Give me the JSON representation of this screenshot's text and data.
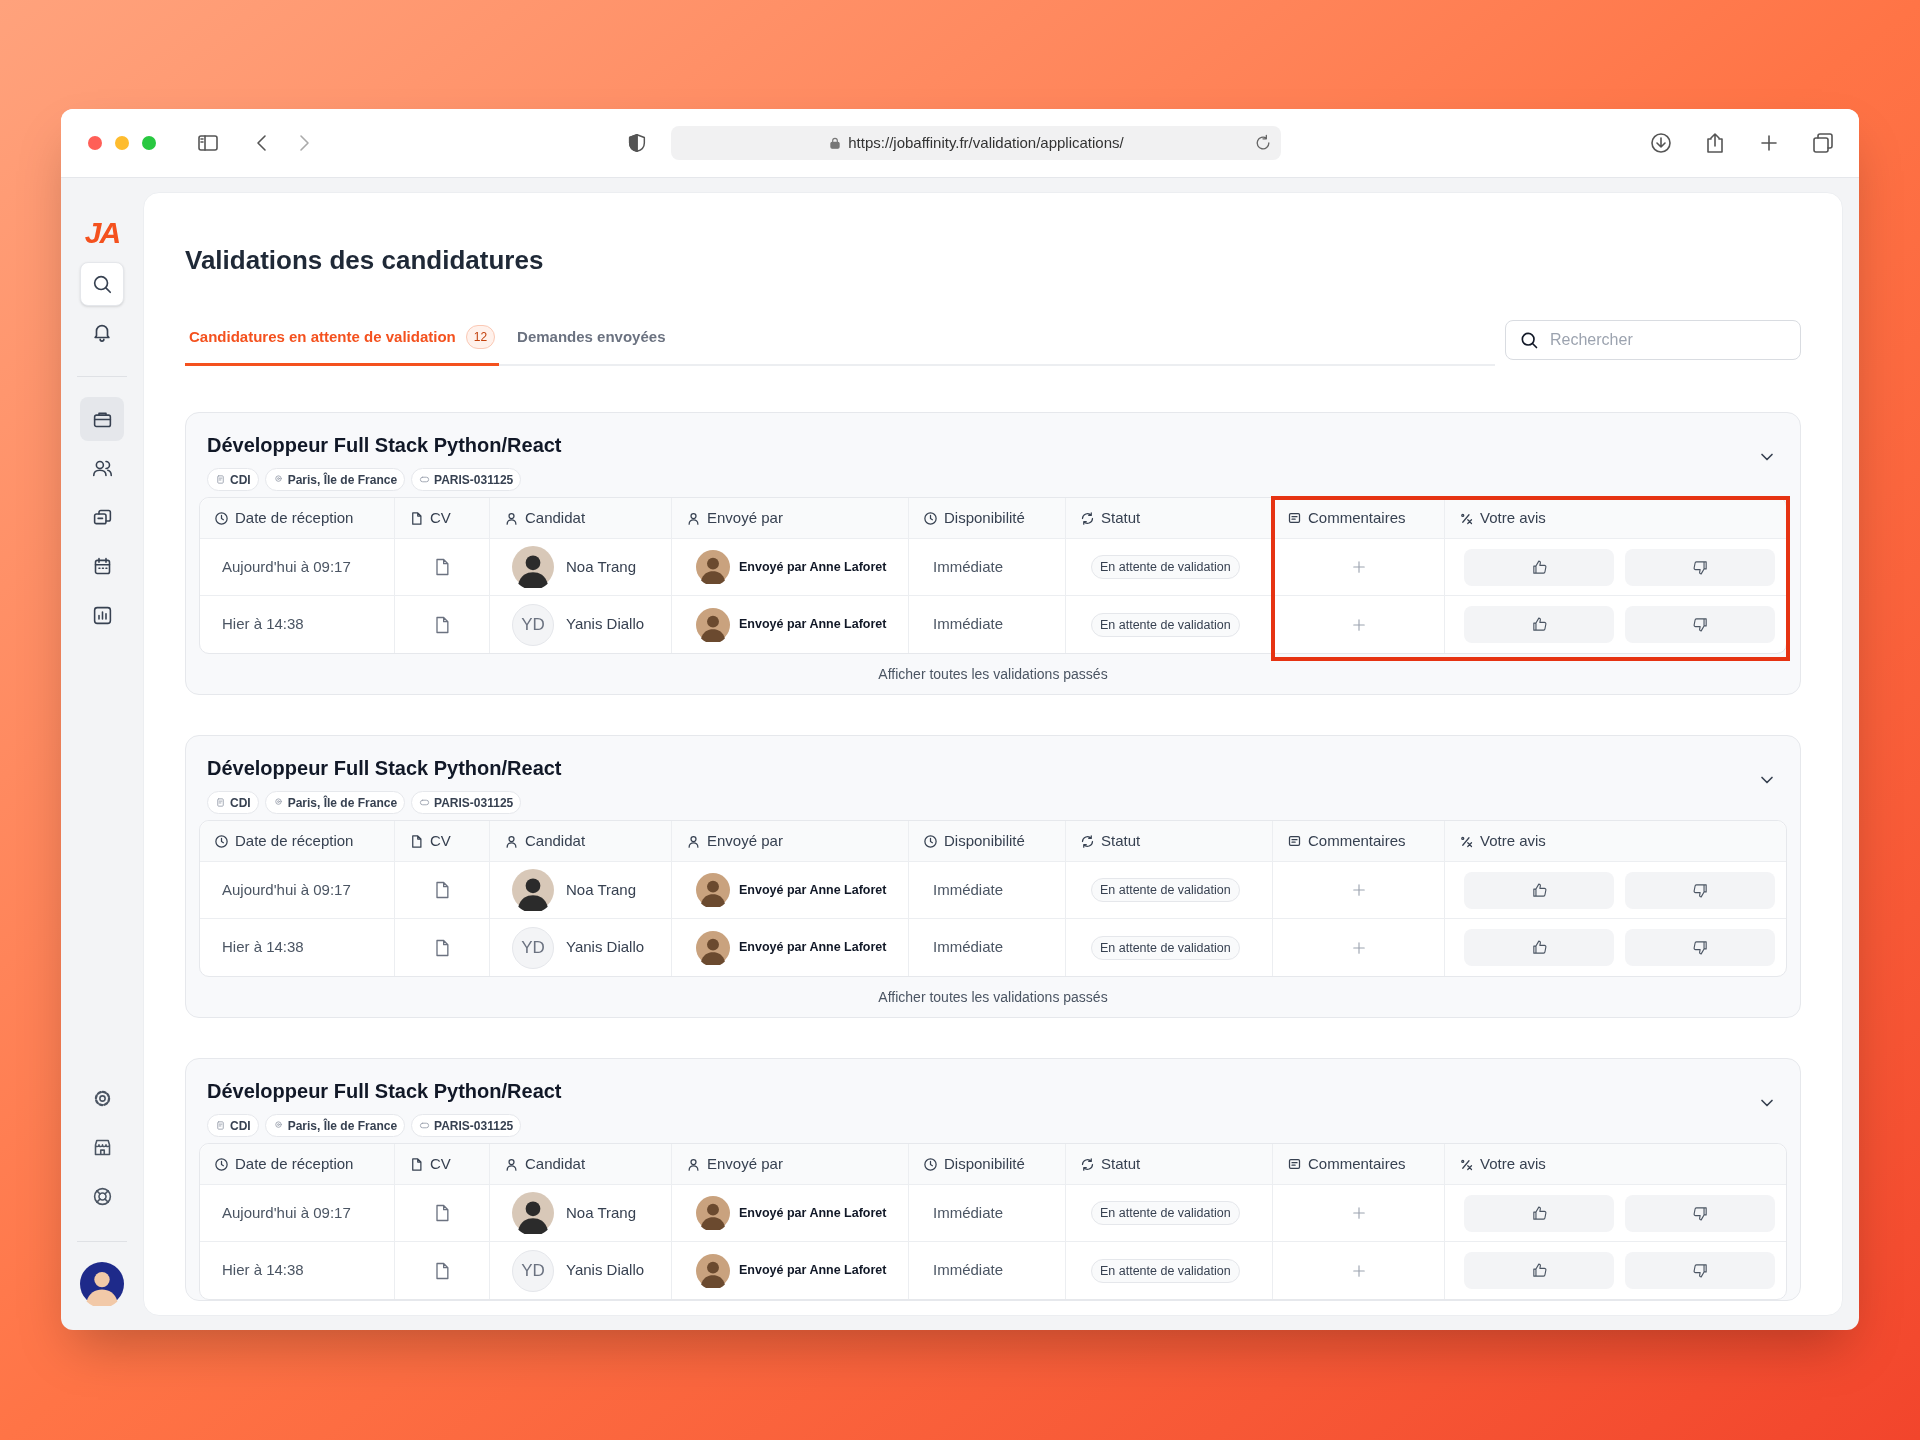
{
  "browser": {
    "url": "https://jobaffinity.fr/validation/applications/"
  },
  "sidebar": {
    "logo": "JA",
    "top_items": [
      {
        "kind": "search",
        "selected": false
      },
      {
        "kind": "nav",
        "selected": false
      }
    ],
    "nav_items": [
      {
        "selected": true
      },
      {
        "selected": false
      },
      {
        "selected": false
      },
      {
        "selected": false
      },
      {
        "selected": false
      }
    ],
    "bottom_items": [
      {
        "selected": false
      },
      {
        "selected": false
      },
      {
        "selected": false
      }
    ]
  },
  "page": {
    "title": "Validations des candidatures",
    "tabs": [
      {
        "label": "Candidatures en attente de validation",
        "badge": "12",
        "selected": true
      },
      {
        "label": "Demandes envoyées",
        "selected": false
      }
    ],
    "search": {
      "placeholder": "Rechercher"
    }
  },
  "cards": [
    {
      "title": "Développeur Full Stack Python/React",
      "highlighted": true,
      "tags": [
        "CDI",
        "Paris, Île de France",
        "PARIS-031125"
      ],
      "columns": [
        "Date de réception",
        "CV",
        "Candidat",
        "Envoyé par",
        "Disponibilité",
        "Statut",
        "Commentaires",
        "Votre avis"
      ],
      "rows": [
        {
          "date": "Aujourd'hui à 09:17",
          "candidate": {
            "name": "Noa Trang"
          },
          "sender": "Envoyé par Anne Laforet",
          "availability": "Immédiate",
          "status": "En attente de validation"
        },
        {
          "date": "Hier à 14:38",
          "candidate": {
            "name": "Yanis Diallo",
            "initials": "YD"
          },
          "sender": "Envoyé par Anne Laforet",
          "availability": "Immédiate",
          "status": "En attente de validation"
        }
      ],
      "footer_link": "Afficher toutes les validations passés"
    },
    {
      "title": "Développeur Full Stack Python/React",
      "highlighted": false,
      "tags": [
        "CDI",
        "Paris, Île de France",
        "PARIS-031125"
      ],
      "columns": [
        "Date de réception",
        "CV",
        "Candidat",
        "Envoyé par",
        "Disponibilité",
        "Statut",
        "Commentaires",
        "Votre avis"
      ],
      "rows": [
        {
          "date": "Aujourd'hui à 09:17",
          "candidate": {
            "name": "Noa Trang"
          },
          "sender": "Envoyé par Anne Laforet",
          "availability": "Immédiate",
          "status": "En attente de validation"
        },
        {
          "date": "Hier à 14:38",
          "candidate": {
            "name": "Yanis Diallo",
            "initials": "YD"
          },
          "sender": "Envoyé par Anne Laforet",
          "availability": "Immédiate",
          "status": "En attente de validation"
        }
      ],
      "footer_link": "Afficher toutes les validations passés"
    },
    {
      "title": "Développeur Full Stack Python/React",
      "highlighted": false,
      "tags": [
        "CDI",
        "Paris, Île de France",
        "PARIS-031125"
      ],
      "columns": [
        "Date de réception",
        "CV",
        "Candidat",
        "Envoyé par",
        "Disponibilité",
        "Statut",
        "Commentaires",
        "Votre avis"
      ],
      "rows": [
        {
          "date": "Aujourd'hui à 09:17",
          "candidate": {
            "name": "Noa Trang"
          },
          "sender": "Envoyé par Anne Laforet",
          "availability": "Immédiate",
          "status": "En attente de validation"
        },
        {
          "date": "Hier à 14:38",
          "candidate": {
            "name": "Yanis Diallo",
            "initials": "YD"
          },
          "sender": "Envoyé par Anne Laforet",
          "availability": "Immédiate",
          "status": "En attente de validation"
        }
      ]
    }
  ]
}
